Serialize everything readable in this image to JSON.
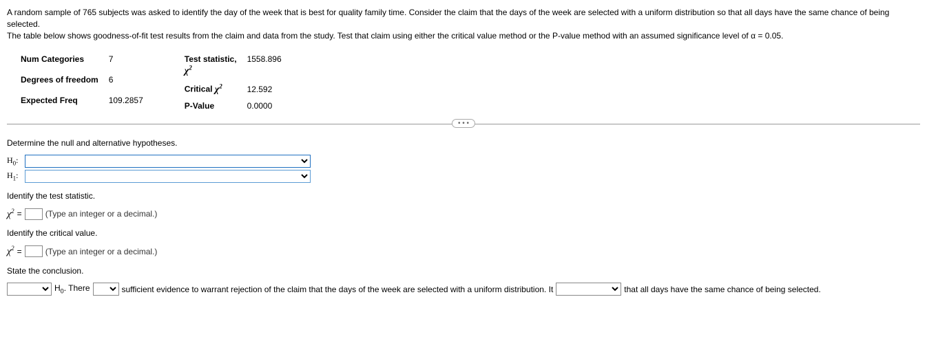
{
  "intro": {
    "line1": "A random sample of 765 subjects was asked to identify the day of the week that is best for quality family time. Consider the claim that the days of the week are selected with a uniform distribution so that all days have the same chance of being selected.",
    "line2": "The table below shows goodness-of-fit test results from the claim and data from the study. Test that claim using either the critical value method or the P-value method with an assumed significance level of α = 0.05."
  },
  "table": {
    "left": {
      "num_categories_label": "Num Categories",
      "num_categories_value": "7",
      "df_label": "Degrees of freedom",
      "df_value": "6",
      "expected_freq_label": "Expected Freq",
      "expected_freq_value": "109.2857"
    },
    "right": {
      "test_stat_label_line1": "Test statistic,",
      "test_stat_value": "1558.896",
      "critical_label": "Critical ",
      "critical_value": "12.592",
      "pvalue_label": "P-Value",
      "pvalue_value": "0.0000"
    }
  },
  "pill": "• • •",
  "q1": {
    "prompt": "Determine the null and alternative hypotheses.",
    "h0_label": "H",
    "h0_sub": "0",
    "h1_label": "H",
    "h1_sub": "1"
  },
  "q2": {
    "prompt": "Identify the test statistic.",
    "hint": "(Type an integer or a decimal.)"
  },
  "q3": {
    "prompt": "Identify the critical value.",
    "hint": "(Type an integer or a decimal.)"
  },
  "q4": {
    "prompt": "State the conclusion.",
    "text_h0": " H",
    "text_h0_sub": "0",
    "text_there": ". There ",
    "text_mid": " sufficient evidence to warrant rejection of the claim that the days of the week are selected with a uniform distribution. It ",
    "text_end": " that all days have the same chance of being selected."
  },
  "chi": "χ",
  "eq": " = "
}
